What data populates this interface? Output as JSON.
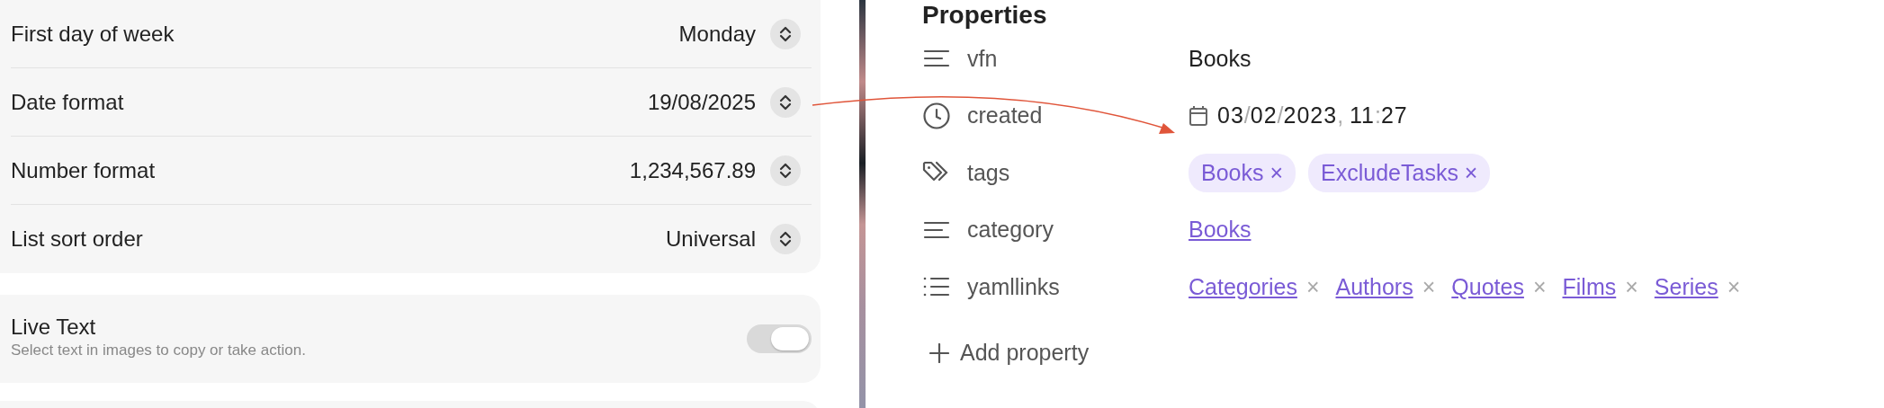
{
  "settings_group": {
    "rows": [
      {
        "label": "First day of week",
        "value": "Monday"
      },
      {
        "label": "Date format",
        "value": "19/08/2025"
      },
      {
        "label": "Number format",
        "value": "1,234,567.89"
      },
      {
        "label": "List sort order",
        "value": "Universal"
      }
    ]
  },
  "live_text": {
    "label": "Live Text",
    "description": "Select text in images to copy or take action.",
    "on": true,
    "disabled": true
  },
  "properties": {
    "title": "Properties",
    "rows": [
      {
        "kind": "text",
        "name": "vfn",
        "value": "Books"
      },
      {
        "kind": "date",
        "name": "created",
        "segments": [
          {
            "text": "03",
            "kind": "digits"
          },
          {
            "text": "/",
            "kind": "sep"
          },
          {
            "text": "02",
            "kind": "digits"
          },
          {
            "text": "/",
            "kind": "sep"
          },
          {
            "text": "2023",
            "kind": "digits"
          },
          {
            "text": ", ",
            "kind": "sep"
          },
          {
            "text": "11",
            "kind": "digits"
          },
          {
            "text": ":",
            "kind": "sep"
          },
          {
            "text": "27",
            "kind": "digits"
          }
        ]
      },
      {
        "kind": "tags",
        "name": "tags",
        "items": [
          "Books",
          "ExcludeTasks"
        ],
        "remove": "×"
      },
      {
        "kind": "link",
        "name": "category",
        "value": "Books"
      },
      {
        "kind": "links",
        "name": "yamllinks",
        "items": [
          "Categories",
          "Authors",
          "Quotes",
          "Films",
          "Series"
        ],
        "remove": "×"
      }
    ],
    "add": "Add property"
  }
}
